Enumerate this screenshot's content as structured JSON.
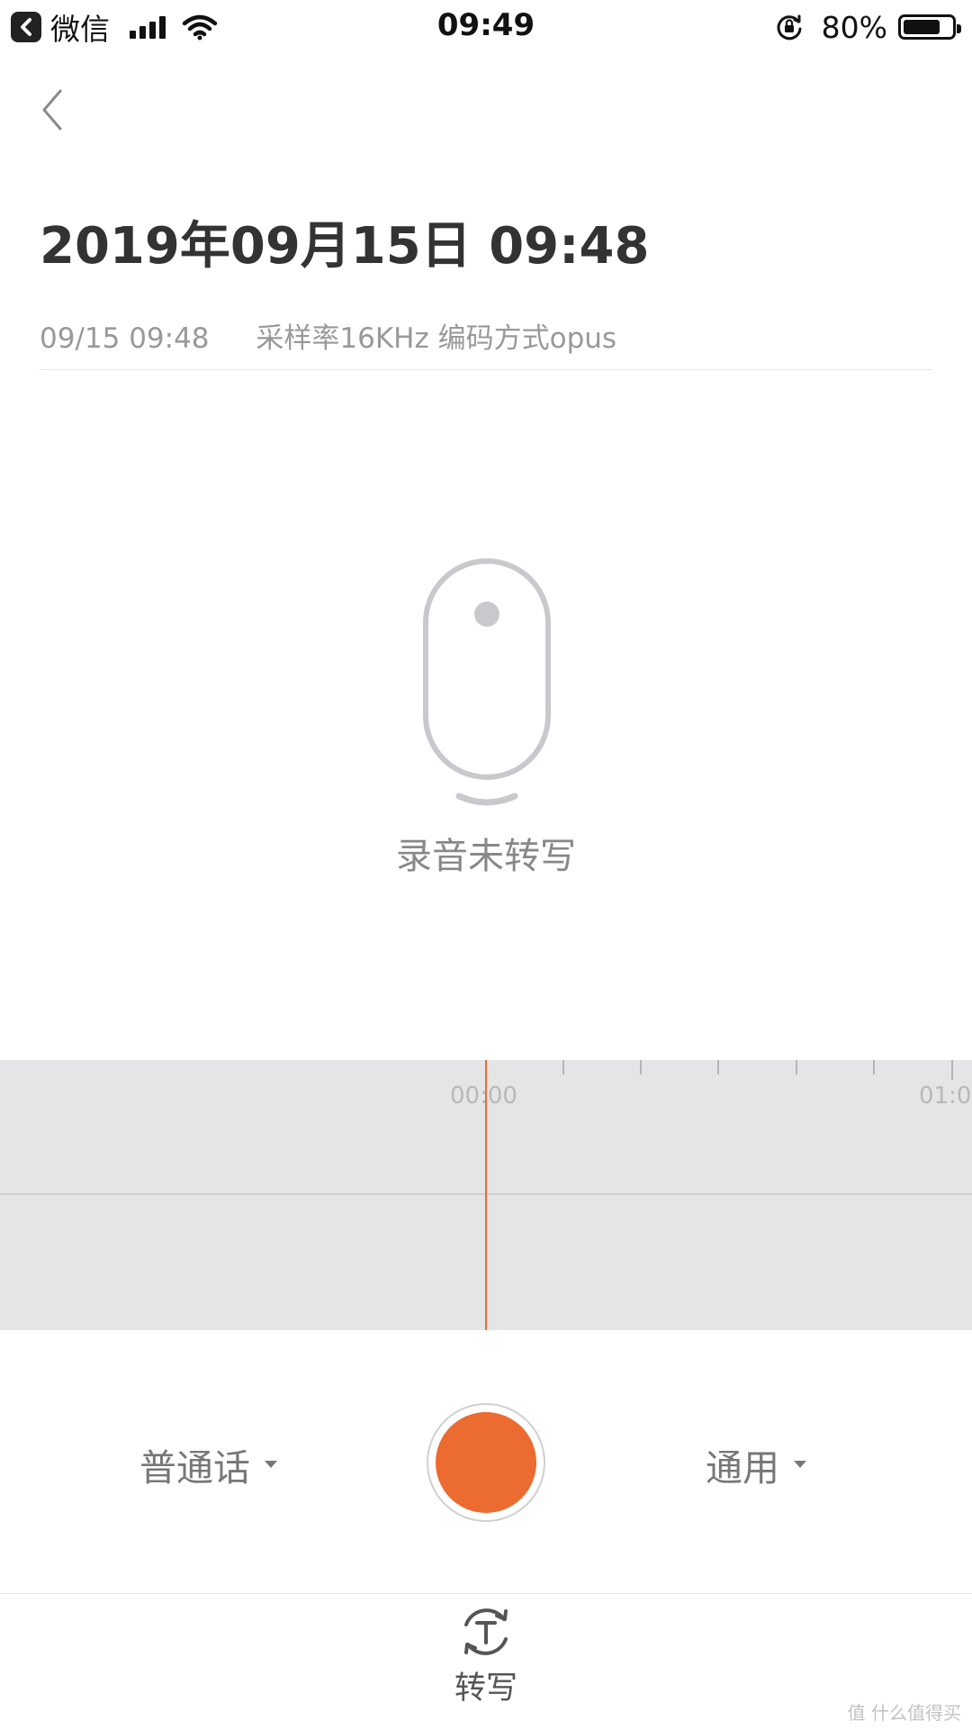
{
  "status_bar": {
    "app_name": "微信",
    "time": "09:49",
    "battery_percent": "80%",
    "battery_level": 0.8,
    "icons": [
      "back-to-app-icon",
      "signal-icon",
      "wifi-icon",
      "rotation-lock-icon",
      "battery-icon"
    ]
  },
  "header": {
    "back_icon": "chevron-left-icon",
    "title": "2019年09月15日 09:48",
    "meta_date": "09/15 09:48",
    "meta_info": "采样率16KHz 编码方式opus"
  },
  "empty_state": {
    "icon": "microphone-icon",
    "text": "录音未转写"
  },
  "timeline": {
    "start_label": "00:00",
    "end_label": "01:0"
  },
  "controls": {
    "language_label": "普通话",
    "scene_label": "通用",
    "record_button_color": "#ec6b30"
  },
  "bottom_bar": {
    "transcribe_icon": "transcribe-icon",
    "transcribe_label": "转写"
  },
  "watermark": "值 什么值得买",
  "colors": {
    "accent": "#ec6b30",
    "timeline_bg": "#e5e5e7",
    "text_primary": "#333333",
    "text_secondary": "#999999"
  }
}
